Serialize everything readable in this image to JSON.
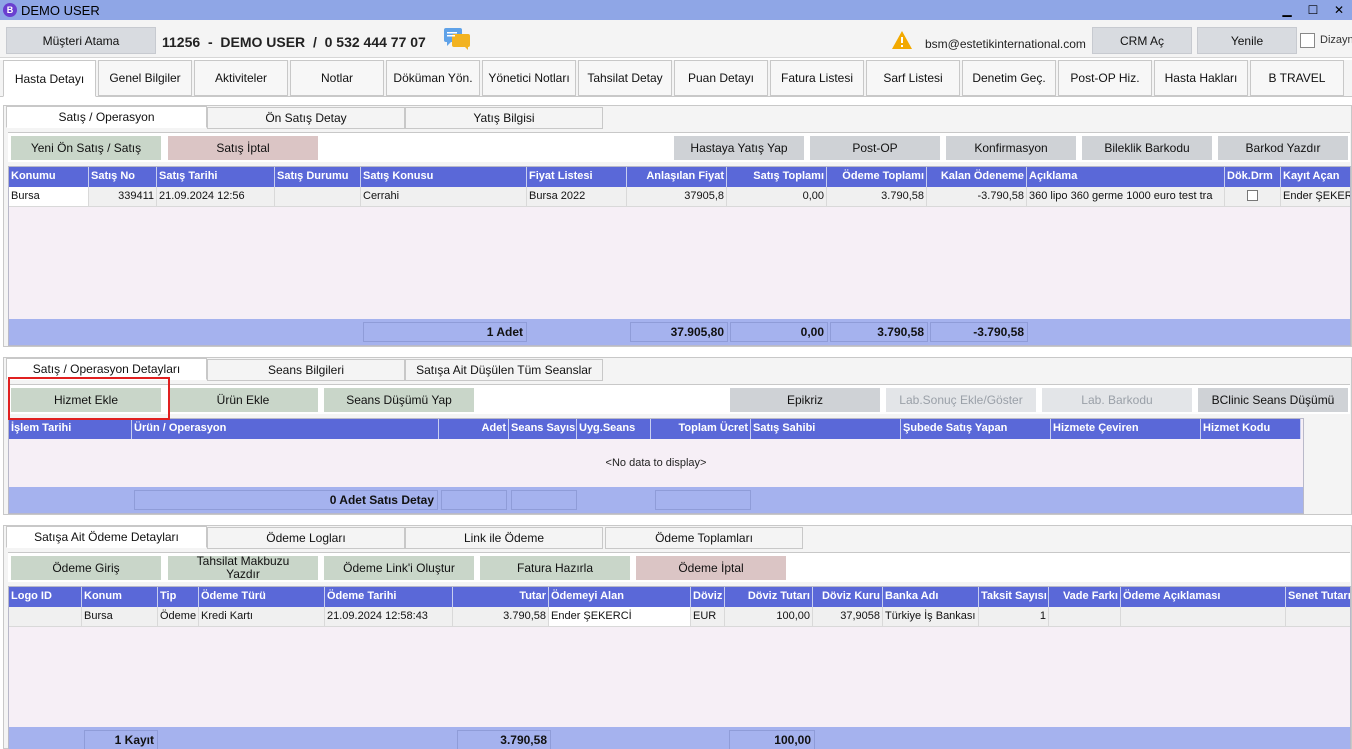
{
  "window": {
    "title": "DEMO USER",
    "icon_letter": "B",
    "min": "▁",
    "max": "☐",
    "close": "✕"
  },
  "header": {
    "musteri_atama": "Müşteri Atama",
    "customer_info": "11256  -  DEMO USER  /  0 532 444 77 07",
    "email": "bsm@estetikinternational.com",
    "crm_ac": "CRM Aç",
    "yenile": "Yenile",
    "dizayn": "Dizayn"
  },
  "main_tabs": [
    "Hasta Detayı",
    "Genel Bilgiler",
    "Aktiviteler",
    "Notlar",
    "Döküman Yön.",
    "Yönetici Notları",
    "Tahsilat Detay",
    "Puan Detayı",
    "Fatura Listesi",
    "Sarf Listesi",
    "Denetim Geç.",
    "Post-OP Hiz.",
    "Hasta Hakları",
    "B TRAVEL"
  ],
  "section1": {
    "tabs": [
      "Satış / Operasyon",
      "Ön Satış Detay",
      "Yatış Bilgisi"
    ],
    "buttons": {
      "yeni_on_satis": "Yeni Ön Satış / Satış",
      "satis_iptal": "Satış İptal",
      "hastaya_yatis": "Hastaya Yatış Yap",
      "post_op": "Post-OP",
      "konfirmasyon": "Konfirmasyon",
      "bileklik": "Bileklik Barkodu",
      "barkod_yazdir": "Barkod Yazdır"
    },
    "columns": [
      "Konumu",
      "Satış No",
      "Satış Tarihi",
      "Satış Durumu",
      "Satış Konusu",
      "Fiyat Listesi",
      "Anlaşılan Fiyat",
      "Satış Toplamı",
      "Ödeme Toplamı",
      "Kalan Ödeneme",
      "Açıklama",
      "Dök.Drm",
      "Kayıt Açan"
    ],
    "row": {
      "konumu": "Bursa",
      "satis_no": "339411",
      "satis_tarihi": "21.09.2024 12:56",
      "satis_durumu": "",
      "satis_konusu": "Cerrahi",
      "fiyat_listesi": "Bursa 2022",
      "anlasilan_fiyat": "37905,8",
      "satis_toplami": "0,00",
      "odeme_toplami": "3.790,58",
      "kalan_odeme": "-3.790,58",
      "aciklama": "360 lipo 360 germe 1000 euro test tra",
      "kayit_acan": "Ender ŞEKER"
    },
    "footer": {
      "adet": "1 Adet",
      "anlasilan": "37.905,80",
      "satis": "0,00",
      "odeme": "3.790,58",
      "kalan": "-3.790,58"
    }
  },
  "section2": {
    "tabs": [
      "Satış / Operasyon Detayları",
      "Seans Bilgileri",
      "Satışa Ait Düşülen Tüm Seanslar"
    ],
    "buttons": {
      "hizmet_ekle": "Hizmet Ekle",
      "urun_ekle": "Ürün Ekle",
      "seans_dusumu": "Seans Düşümü Yap",
      "epikriz": "Epikriz",
      "lab_sonuc": "Lab.Sonuç Ekle/Göster",
      "lab_barkodu": "Lab. Barkodu",
      "bclinic": "BClinic Seans Düşümü"
    },
    "columns": [
      "İşlem Tarihi",
      "Ürün / Operasyon",
      "Adet",
      "Seans Sayısı",
      "Uyg.Seans",
      "Toplam Ücret",
      "Satış Sahibi",
      "Şubede Satış Yapan",
      "Hizmete Çeviren",
      "Hizmet Kodu"
    ],
    "no_data": "<No data to display>",
    "footer": {
      "adet": "0 Adet Satıs Detay"
    }
  },
  "section3": {
    "tabs": [
      "Satışa Ait Ödeme Detayları",
      "Ödeme Logları",
      "Link ile Ödeme",
      "Ödeme Toplamları"
    ],
    "buttons": {
      "odeme_giris": "Ödeme Giriş",
      "tahsilat_makbuzu": "Tahsilat Makbuzu Yazdır",
      "odeme_link": "Ödeme Link'i Oluştur",
      "fatura": "Fatura Hazırla",
      "odeme_iptal": "Ödeme İptal"
    },
    "columns": [
      "Logo ID",
      "Konum",
      "Tip",
      "Ödeme Türü",
      "Ödeme Tarihi",
      "Tutar",
      "Ödemeyi Alan",
      "Döviz",
      "Döviz Tutarı",
      "Döviz Kuru",
      "Banka Adı",
      "Taksit Sayısı",
      "Vade Farkı",
      "Ödeme Açıklaması",
      "Senet Tutarı"
    ],
    "row": {
      "logo_id": "",
      "konum": "Bursa",
      "tip": "Ödeme",
      "odeme_turu": "Kredi Kartı",
      "odeme_tarihi": "21.09.2024 12:58:43",
      "tutar": "3.790,58",
      "odemeyi_alan": "Ender ŞEKERCİ",
      "doviz": "EUR",
      "doviz_tutari": "100,00",
      "doviz_kuru": "37,9058",
      "banka": "Türkiye İş Bankası",
      "taksit": "1",
      "vade": "",
      "aciklama": "",
      "senet": ""
    },
    "footer": {
      "kayit": "1 Kayıt",
      "tutar": "3.790,58",
      "doviz_tutari": "100,00"
    }
  }
}
